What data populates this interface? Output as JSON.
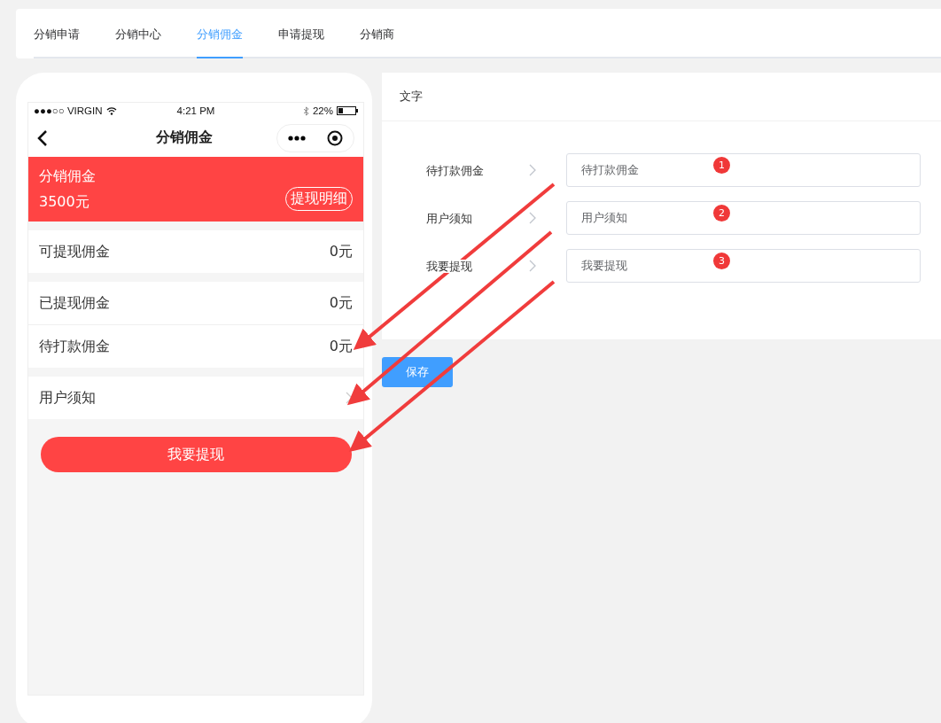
{
  "tabs": [
    {
      "label": "分销申请",
      "selected": false
    },
    {
      "label": "分销中心",
      "selected": false
    },
    {
      "label": "分销佣金",
      "selected": true
    },
    {
      "label": "申请提现",
      "selected": false
    },
    {
      "label": "分销商",
      "selected": false
    }
  ],
  "phone": {
    "status_bar": {
      "carrier": "●●●○○ VIRGIN",
      "time": "4:21 PM",
      "battery": "22%"
    },
    "nav_title": "分销佣金",
    "header": {
      "title": "分销佣金",
      "amount": "3500元",
      "button": "提现明细"
    },
    "sections": [
      [
        {
          "kind": "value",
          "label": "可提现佣金",
          "value": "0元"
        }
      ],
      [
        {
          "kind": "value",
          "label": "已提现佣金",
          "value": "0元"
        },
        {
          "kind": "value",
          "label": "待打款佣金",
          "value": "0元"
        }
      ],
      [
        {
          "kind": "link",
          "label": "用户须知"
        }
      ]
    ],
    "action_button": "我要提现"
  },
  "panel": {
    "title": "文字",
    "fields": [
      {
        "label": "待打款佣金",
        "value": "待打款佣金",
        "badge": "1"
      },
      {
        "label": "用户须知",
        "value": "用户须知",
        "badge": "2"
      },
      {
        "label": "我要提现",
        "value": "我要提现",
        "badge": "3"
      }
    ]
  },
  "save_button": "保存"
}
